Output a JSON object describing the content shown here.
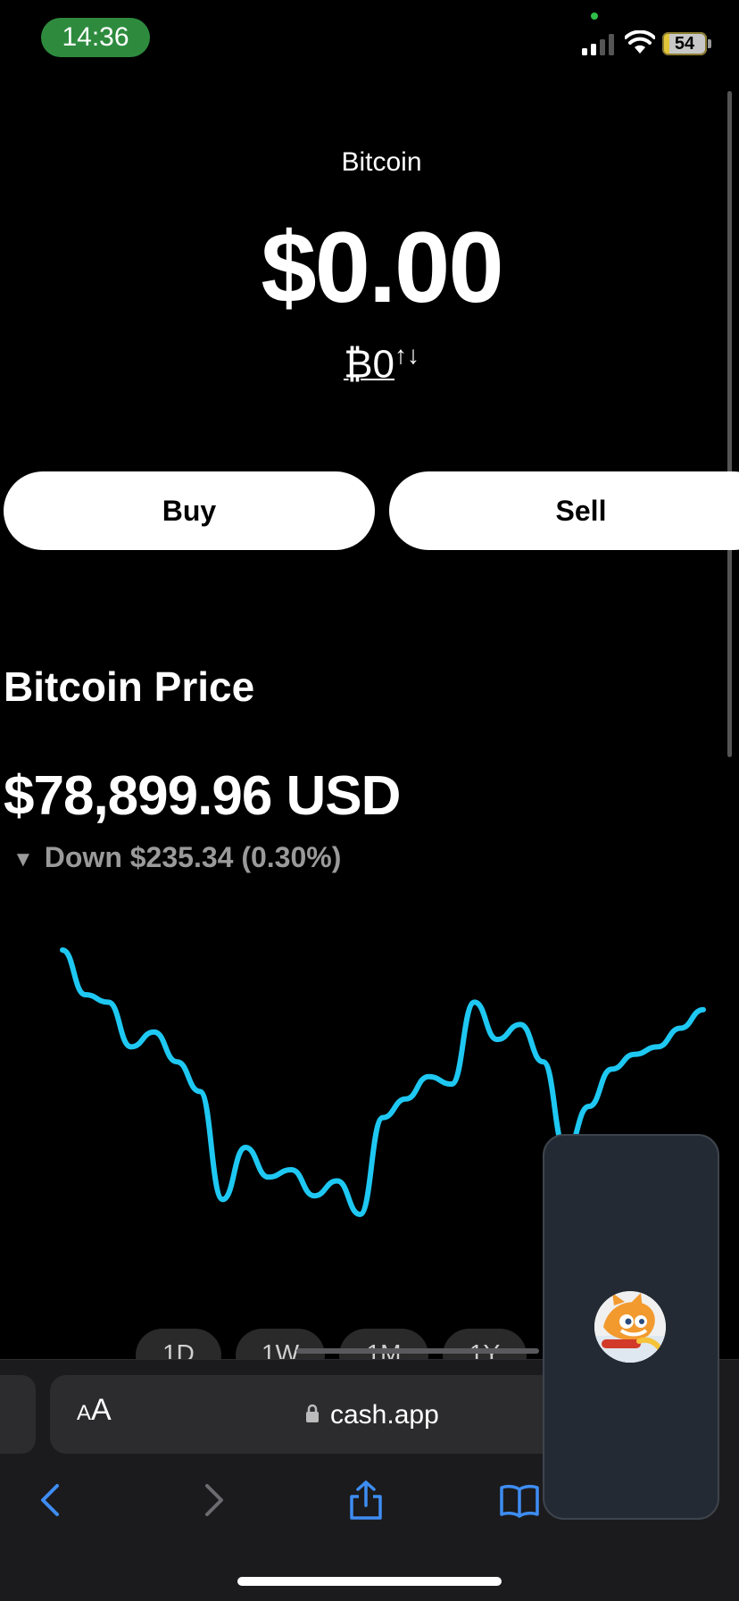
{
  "status_bar": {
    "time": "14:36",
    "battery": "54"
  },
  "header": {
    "asset_title": "Bitcoin",
    "balance": "$0.00",
    "btc_balance": "₿0",
    "swap_glyph": "↑↓"
  },
  "actions": {
    "buy_label": "Buy",
    "sell_label": "Sell"
  },
  "price_section": {
    "heading": "Bitcoin Price",
    "price": "$78,899.96 USD",
    "change_direction_glyph": "▼",
    "change_text": "Down $235.34 (0.30%)",
    "line_color": "#1ec8f2"
  },
  "chart_data": {
    "type": "line",
    "title": "",
    "xlabel": "",
    "ylabel": "",
    "grid": false,
    "series": [
      {
        "values": [
          100,
          88,
          86,
          74,
          78,
          70,
          62,
          33,
          47,
          39,
          41,
          34,
          38,
          29,
          55,
          60,
          66,
          64,
          86,
          76,
          80,
          70,
          46,
          58,
          68,
          72,
          74,
          79,
          84
        ]
      }
    ]
  },
  "range_tabs": [
    "1D",
    "1W",
    "1M",
    "1Y"
  ],
  "browser": {
    "aa_small": "A",
    "aa_large": "A",
    "url": "cash.app"
  },
  "accent_blue": "#3e8df3"
}
